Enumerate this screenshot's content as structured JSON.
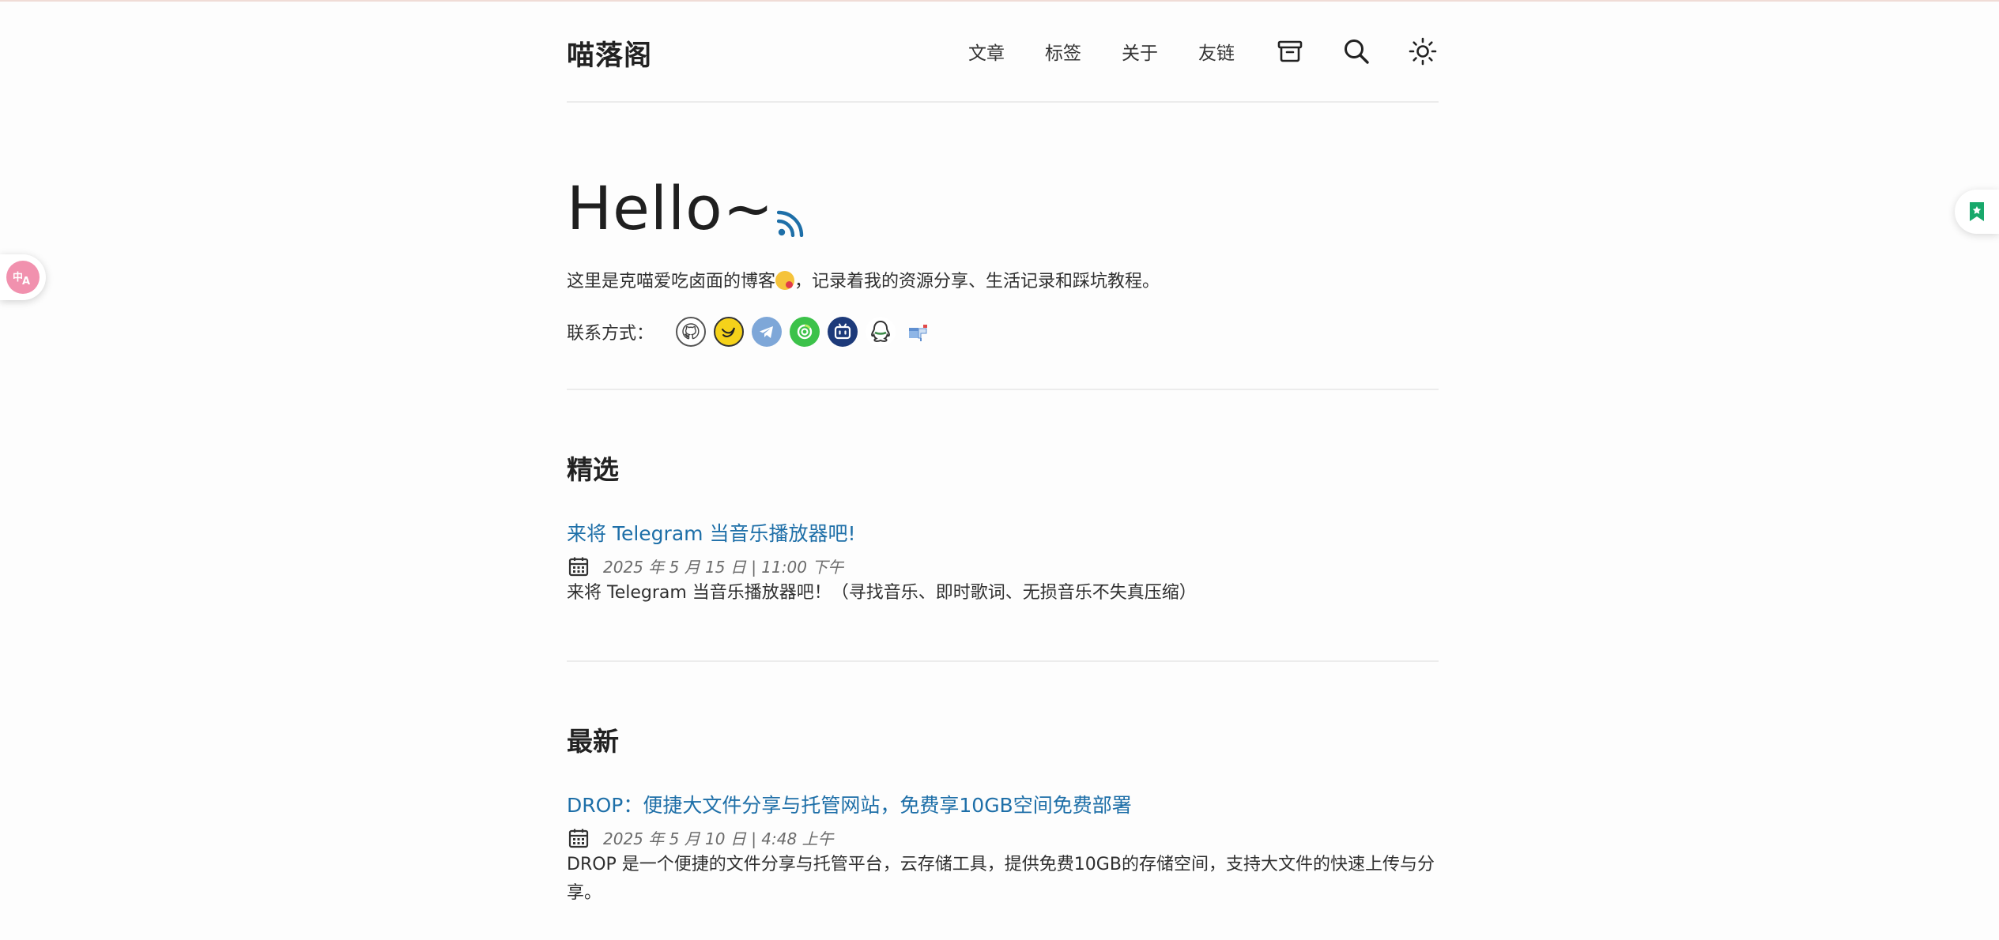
{
  "site": {
    "title": "喵落阁"
  },
  "nav": {
    "items": [
      {
        "label": "文章"
      },
      {
        "label": "标签"
      },
      {
        "label": "关于"
      },
      {
        "label": "友链"
      }
    ],
    "icons": [
      "archive-icon",
      "search-icon",
      "sun-icon"
    ]
  },
  "hero": {
    "title": "Hello~",
    "desc_before": "这里是克喵爱吃卤面的博客",
    "desc_after": "，记录着我的资源分享、生活记录和踩坑教程。",
    "contact_label": "联系方式：",
    "social": [
      "github-icon",
      "bird-icon",
      "telegram-icon",
      "green-swirl-icon",
      "bilibili-icon",
      "qq-icon",
      "mail-icon"
    ]
  },
  "featured": {
    "heading": "精选",
    "posts": [
      {
        "title": "来将 Telegram 当音乐播放器吧!",
        "date": "2025 年 5 月 15 日 | 11:00 下午",
        "desc": "来将 Telegram 当音乐播放器吧！（寻找音乐、即时歌词、无损音乐不失真压缩）"
      }
    ]
  },
  "latest": {
    "heading": "最新",
    "posts": [
      {
        "title": "DROP：便捷大文件分享与托管网站，免费享10GB空间免费部署",
        "date": "2025 年 5 月 10 日 | 4:48 上午",
        "desc": "DROP 是一个便捷的文件分享与托管平台，云存储工具，提供免费10GB的存储空间，支持大文件的快速上传与分享。"
      }
    ]
  },
  "colors": {
    "link": "#1e6fa8",
    "rss": "#1e6fa8",
    "translate_bg": "#f191ae",
    "bookmark": "#18a86b"
  }
}
